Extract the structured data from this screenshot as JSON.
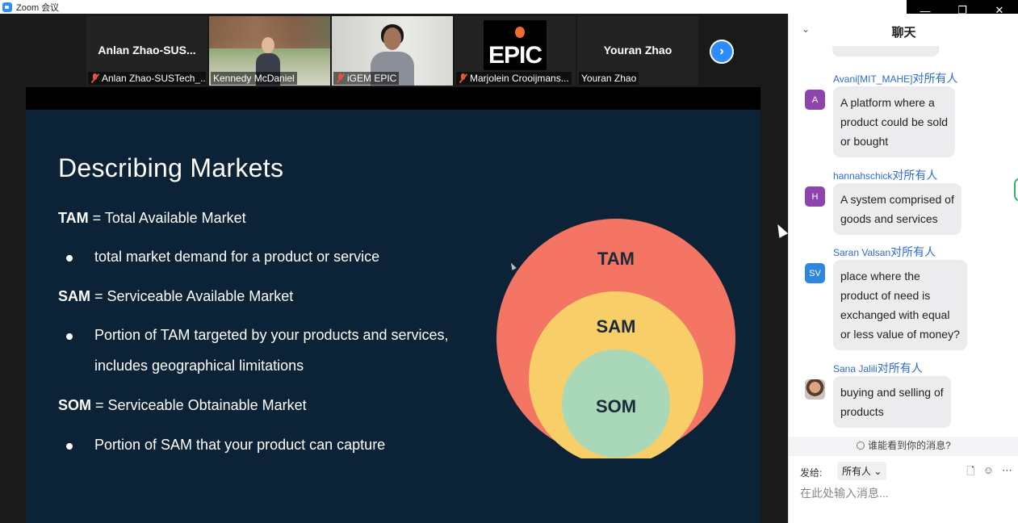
{
  "window": {
    "title": "Zoom 会议",
    "controls": [
      "—",
      "❐",
      "✕"
    ]
  },
  "participants": [
    {
      "big_name": "Anlan  Zhao-SUS...",
      "label": "Anlan Zhao-SUSTech_...",
      "muted": true
    },
    {
      "big_name": "",
      "label": "Kennedy McDaniel",
      "muted": false
    },
    {
      "big_name": "",
      "label": "iGEM EPIC",
      "muted": true
    },
    {
      "big_name": "",
      "label": "Marjolein Crooijmans...",
      "muted": true,
      "logo_text": "EPIC"
    },
    {
      "big_name": "Youran Zhao",
      "label": "Youran Zhao",
      "muted": false
    }
  ],
  "next_button": "›",
  "slide": {
    "title": "Describing Markets",
    "tam_abbr": "TAM",
    "tam_def": " = Total Available Market",
    "tam_bullet": "total market demand for a product or service",
    "sam_abbr": "SAM",
    "sam_def": " = Serviceable Available Market",
    "sam_bullet_1": "Portion of TAM targeted by your products and services,",
    "sam_bullet_2": "includes geographical limitations",
    "som_abbr": "SOM",
    "som_def": " = Serviceable Obtainable Market",
    "som_bullet": "Portion of SAM that your product can capture",
    "diagram": {
      "outer_label": "TAM",
      "outer_color": "#f47564",
      "middle_label": "SAM",
      "middle_color": "#f8ce68",
      "inner_label": "SOM",
      "inner_color": "#a9d8b8"
    }
  },
  "chat": {
    "title": "聊天",
    "collapse_icon": "⌄",
    "to_word": "对",
    "to_all": "所有人",
    "messages": [
      {
        "sender": "Avani[MIT_MAHE]",
        "initials": "A",
        "color": "#8e44ad",
        "lines": [
          "A platform where a",
          "product could be sold",
          "or bought"
        ]
      },
      {
        "sender": "hannahschick",
        "initials": "H",
        "color": "#8e44ad",
        "lines": [
          "A system comprised of",
          "goods and services"
        ]
      },
      {
        "sender": "Saran Valsan",
        "initials": "SV",
        "color": "#2e86de",
        "lines": [
          "place where the",
          "product of need is",
          "exchanged with equal",
          "or less value of money?"
        ]
      },
      {
        "sender": "Sana  Jalili",
        "initials": "",
        "color": "",
        "photo": true,
        "lines": [
          "buying and selling of",
          "products"
        ]
      }
    ],
    "who_can_see": "谁能看到你的消息?",
    "send_to_label": "发给:",
    "send_to_value": "所有人",
    "input_placeholder": "在此处输入消息..."
  }
}
